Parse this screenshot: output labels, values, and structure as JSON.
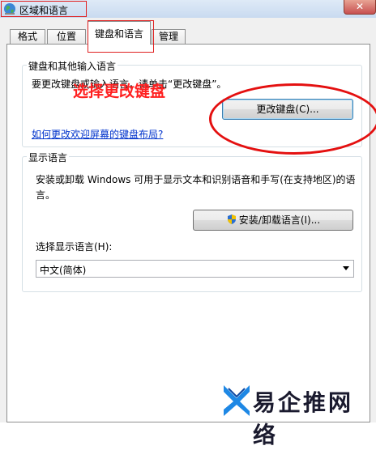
{
  "window": {
    "title": "区域和语言",
    "close_label": "✕"
  },
  "tabs": [
    {
      "label": "格式"
    },
    {
      "label": "位置"
    },
    {
      "label": "键盘和语言",
      "active": true
    },
    {
      "label": "管理"
    }
  ],
  "keyboard_group": {
    "title": "键盘和其他输入语言",
    "description": "要更改键盘或输入语言，请单击“更改键盘”。",
    "change_button": "更改键盘(C)...",
    "link": "如何更改欢迎屏幕的键盘布局?"
  },
  "display_group": {
    "title": "显示语言",
    "description_line1": "安装或卸载 Windows 可用于显示文本和识别语音和手写(在支持地区)的语",
    "description_line2": "言。",
    "install_button": "安装/卸载语言(I)...",
    "select_label": "选择显示语言(H):",
    "select_value": "中文(简体)"
  },
  "annotation": {
    "text": "选择更改键盘",
    "color": "#ff2020"
  },
  "watermark": {
    "text": "易企推网络"
  }
}
